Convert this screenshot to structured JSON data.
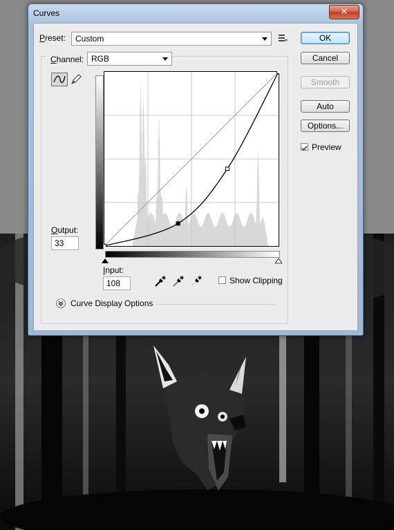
{
  "window": {
    "title": "Curves",
    "close_label": "✕"
  },
  "preset": {
    "label": "Preset:",
    "accel": "P",
    "rest": "reset:",
    "value": "Custom",
    "menu_icon": "preset-options-icon"
  },
  "channel": {
    "label_accel": "C",
    "label_rest": "hannel:",
    "value": "RGB"
  },
  "buttons": {
    "ok": "OK",
    "cancel": "Cancel",
    "smooth": "Smooth",
    "auto": "Auto",
    "options": "Options..."
  },
  "preview": {
    "label": "Preview",
    "checked": true
  },
  "output": {
    "label": "Output:",
    "value": "33"
  },
  "input": {
    "label": "Input:",
    "value": "108"
  },
  "show_clipping": {
    "label": "Show Clipping",
    "checked": false
  },
  "curve_display": {
    "label": "Curve Display Options"
  },
  "colors": {
    "accent": "#3c7fb1",
    "close": "#c7432a",
    "grid": "#c8c8c8"
  },
  "curve": {
    "points": [
      [
        0,
        0
      ],
      [
        108,
        33
      ],
      [
        180,
        113
      ],
      [
        255,
        255
      ]
    ]
  }
}
